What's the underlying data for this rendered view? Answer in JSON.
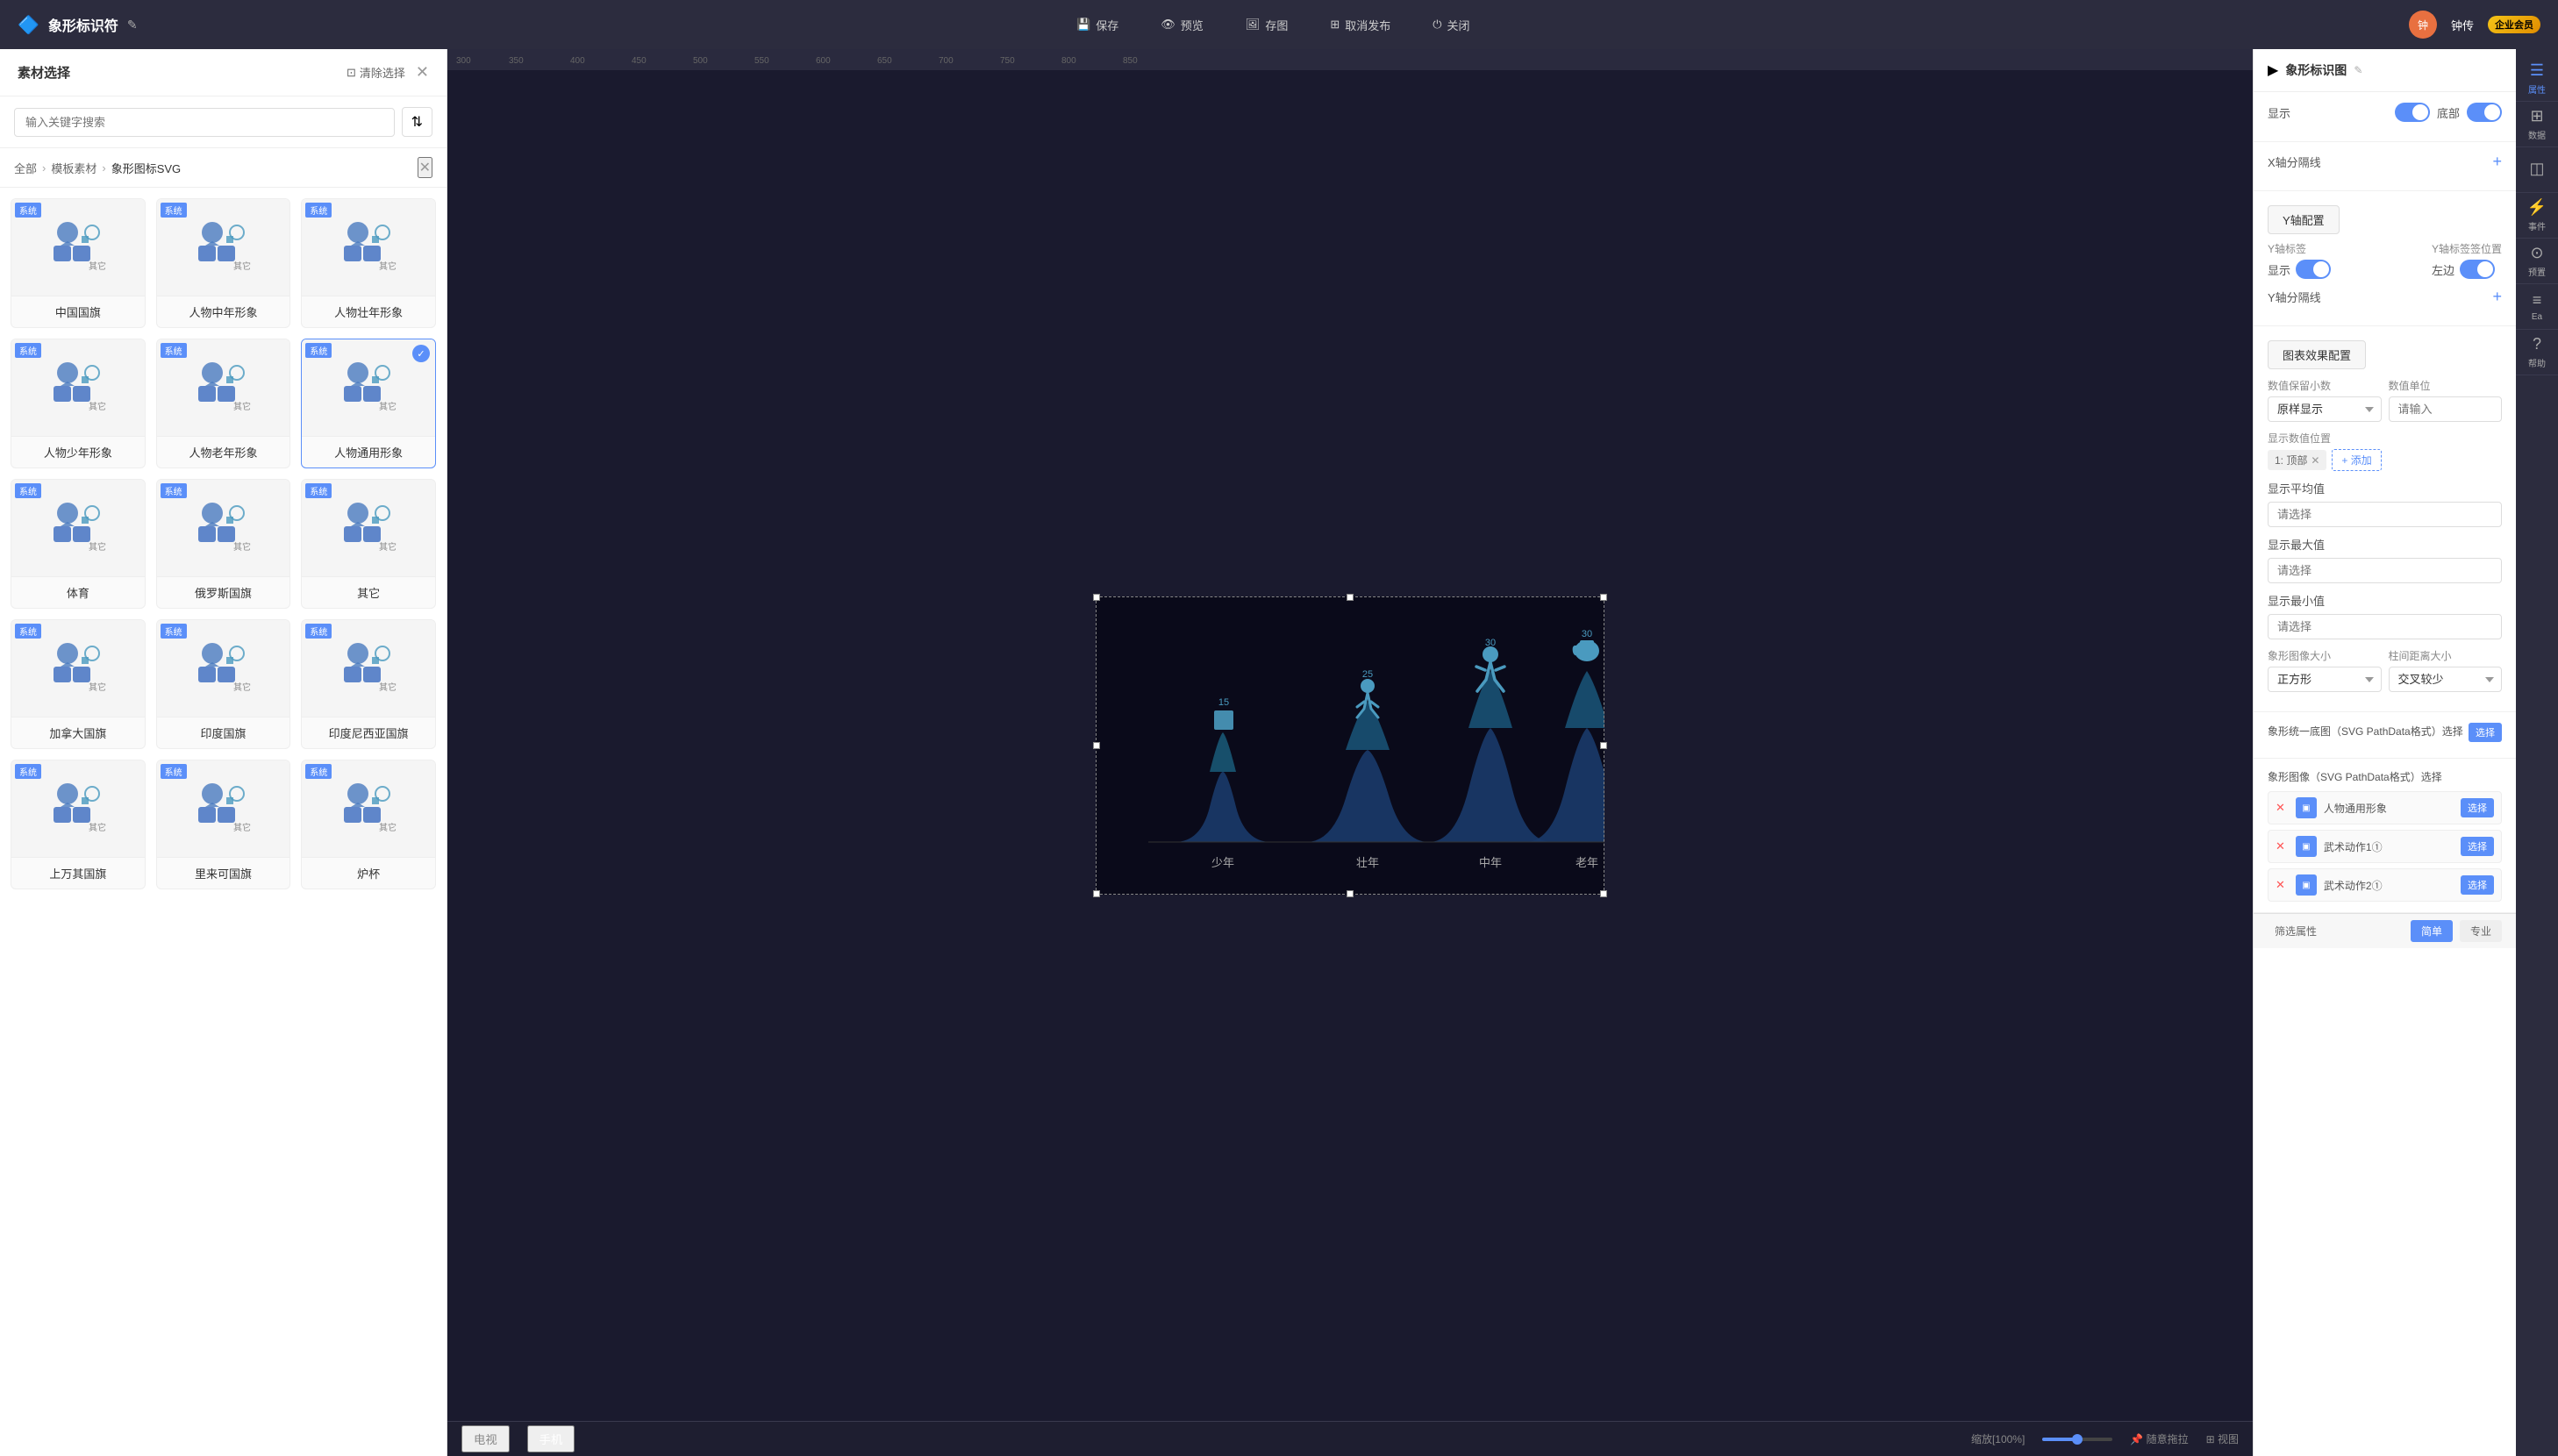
{
  "app": {
    "title": "象形标识符",
    "edit_icon": "✎"
  },
  "topbar": {
    "save_label": "保存",
    "preview_label": "预览",
    "export_label": "存图",
    "unpublish_label": "取消发布",
    "close_label": "关闭",
    "user_name": "钟传",
    "vip_label": "企业会员"
  },
  "left_panel": {
    "title": "素材选择",
    "clear_label": "清除选择",
    "search_placeholder": "输入关键字搜索",
    "breadcrumb": [
      "全部",
      "模板素材",
      "象形图标SVG"
    ],
    "materials": [
      {
        "name": "中国国旗",
        "tag": "系统",
        "selected": false
      },
      {
        "name": "人物中年形象",
        "tag": "系统",
        "selected": false
      },
      {
        "name": "人物壮年形象",
        "tag": "系统",
        "selected": false
      },
      {
        "name": "人物少年形象",
        "tag": "系统",
        "selected": false
      },
      {
        "name": "人物老年形象",
        "tag": "系统",
        "selected": false
      },
      {
        "name": "人物通用形象",
        "tag": "系统",
        "selected": true
      },
      {
        "name": "体育",
        "tag": "系统",
        "selected": false
      },
      {
        "name": "俄罗斯国旗",
        "tag": "系统",
        "selected": false
      },
      {
        "name": "其它",
        "tag": "系统",
        "selected": false
      },
      {
        "name": "加拿大国旗",
        "tag": "系统",
        "selected": false
      },
      {
        "name": "印度国旗",
        "tag": "系统",
        "selected": false
      },
      {
        "name": "印度尼西亚国旗",
        "tag": "系统",
        "selected": false
      },
      {
        "name": "上万其国旗",
        "tag": "系统",
        "selected": false
      },
      {
        "name": "里来可国旗",
        "tag": "系统",
        "selected": false
      },
      {
        "name": "炉杯",
        "tag": "系统",
        "selected": false
      }
    ]
  },
  "chart": {
    "categories": [
      "少年",
      "壮年",
      "中年",
      "老年"
    ],
    "values": [
      15,
      25,
      30,
      30
    ],
    "zoom": "100%"
  },
  "bottom_bar": {
    "tabs": [
      "电视",
      "手机"
    ],
    "zoom_label": "缩放[100%]",
    "drag_label": "随意拖拉",
    "view_label": "视图"
  },
  "right_panel": {
    "title": "象形标识图",
    "show_label": "显示",
    "bottom_label": "底部",
    "x_axis_label": "X轴分隔线",
    "add_x_label": "+",
    "y_axis_config_label": "Y轴配置",
    "y_axis_label_text": "Y轴标签",
    "show_y_label": "显示",
    "y_axis_pos_label": "Y轴标签签位置",
    "left_label": "左边",
    "y_sep_label": "Y轴分隔线",
    "add_y_label": "+",
    "chart_effect_label": "图表效果配置",
    "decimal_label": "数值保留小数",
    "decimal_value": "原样显示",
    "unit_label": "数值单位",
    "unit_placeholder": "请输入",
    "display_pos_label": "显示数值位置",
    "display_pos_tag": "1: 顶部",
    "add_display_label": "+ 添加",
    "avg_label": "显示平均值",
    "avg_placeholder": "请选择",
    "max_label": "显示最大值",
    "max_placeholder": "请选择",
    "min_label": "显示最小值",
    "min_placeholder": "请选择",
    "img_size_label": "象形图像大小",
    "img_size_value": "正方形",
    "col_gap_label": "柱间距离大小",
    "col_gap_value": "交叉较少",
    "unified_label": "象形统一底图（SVG PathData格式）选择",
    "select_btn_label": "选择",
    "individual_label": "象形图像（SVG PathData格式）选择",
    "image_items": [
      {
        "x": "✕",
        "name": "人物通用形象",
        "btn": "选择"
      },
      {
        "x": "✕",
        "name": "武术动作1①",
        "btn": "选择"
      },
      {
        "x": "✕",
        "name": "武术动作2①",
        "btn": "选择"
      }
    ]
  },
  "far_right": {
    "items": [
      {
        "icon": "☰",
        "label": "属性"
      },
      {
        "icon": "⊞",
        "label": "数据"
      },
      {
        "icon": "◫",
        "label": ""
      },
      {
        "icon": "⚡",
        "label": "事件"
      },
      {
        "icon": "⊙",
        "label": "预置"
      },
      {
        "icon": "≡",
        "label": "Ea"
      },
      {
        "icon": "?",
        "label": "帮助"
      }
    ]
  },
  "filter_bar": {
    "filter_label": "筛选属性",
    "simple_label": "简单",
    "pro_label": "专业"
  }
}
